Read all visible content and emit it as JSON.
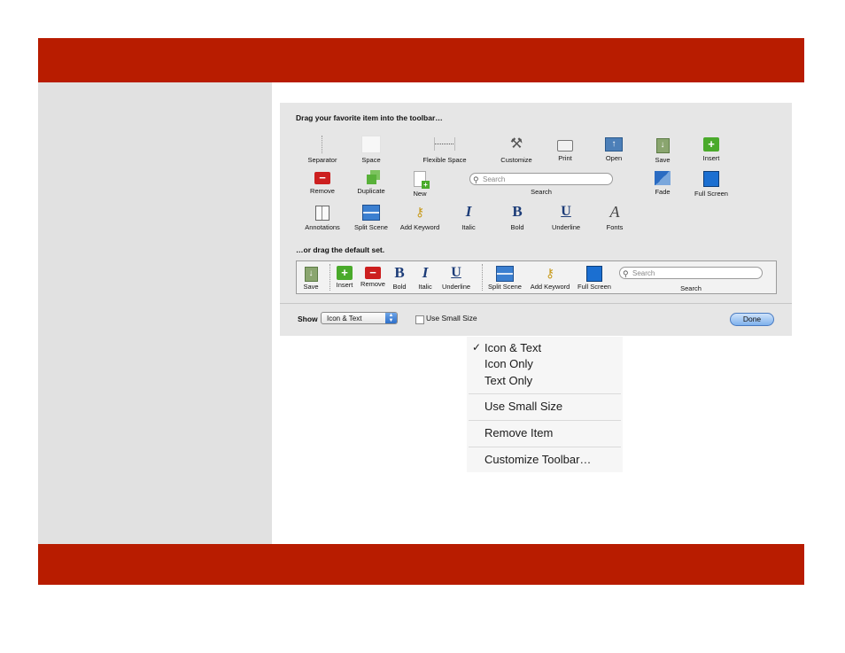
{
  "colors": {
    "accent_bar": "#b81c00",
    "sidebar": "#e1e1e1"
  },
  "sheet": {
    "heading_favorite": "Drag your favorite item into the toolbar…",
    "heading_default": "…or drag the default set.",
    "items": [
      {
        "label": "Separator",
        "icon": "separator-icon"
      },
      {
        "label": "Space",
        "icon": "space-icon"
      },
      {
        "label": "Flexible Space",
        "icon": "flexible-space-icon"
      },
      {
        "label": "Customize",
        "icon": "tools-icon"
      },
      {
        "label": "Print",
        "icon": "printer-icon"
      },
      {
        "label": "Open",
        "icon": "open-icon"
      },
      {
        "label": "Save",
        "icon": "save-icon"
      },
      {
        "label": "Insert",
        "icon": "insert-icon"
      },
      {
        "label": "Remove",
        "icon": "remove-icon"
      },
      {
        "label": "Duplicate",
        "icon": "duplicate-icon"
      },
      {
        "label": "New",
        "icon": "new-document-icon"
      },
      {
        "label": "Search",
        "icon": "search-icon"
      },
      {
        "label": "Fade",
        "icon": "fade-icon"
      },
      {
        "label": "Full Screen",
        "icon": "full-screen-icon"
      },
      {
        "label": "Annotations",
        "icon": "annotations-icon"
      },
      {
        "label": "Split Scene",
        "icon": "split-scene-icon"
      },
      {
        "label": "Add Keyword",
        "icon": "add-keyword-icon"
      },
      {
        "label": "Italic",
        "icon": "italic-icon"
      },
      {
        "label": "Bold",
        "icon": "bold-icon"
      },
      {
        "label": "Underline",
        "icon": "underline-icon"
      },
      {
        "label": "Fonts",
        "icon": "fonts-icon"
      }
    ],
    "search_placeholder": "Search",
    "default_set": [
      {
        "label": "Save"
      },
      {
        "label": "Insert"
      },
      {
        "label": "Remove"
      },
      {
        "label": "Bold"
      },
      {
        "label": "Italic"
      },
      {
        "label": "Underline"
      },
      {
        "label": "Split Scene"
      },
      {
        "label": "Add Keyword"
      },
      {
        "label": "Full Screen"
      },
      {
        "label": "Search"
      }
    ],
    "default_search_placeholder": "Search",
    "show_label": "Show",
    "show_value": "Icon & Text",
    "small_size_label": "Use Small Size",
    "done_label": "Done"
  },
  "menu": {
    "check_mark": "✓",
    "items": [
      "Icon & Text",
      "Icon Only",
      "Text Only",
      "Use Small Size",
      "Remove Item",
      "Customize Toolbar…"
    ]
  }
}
